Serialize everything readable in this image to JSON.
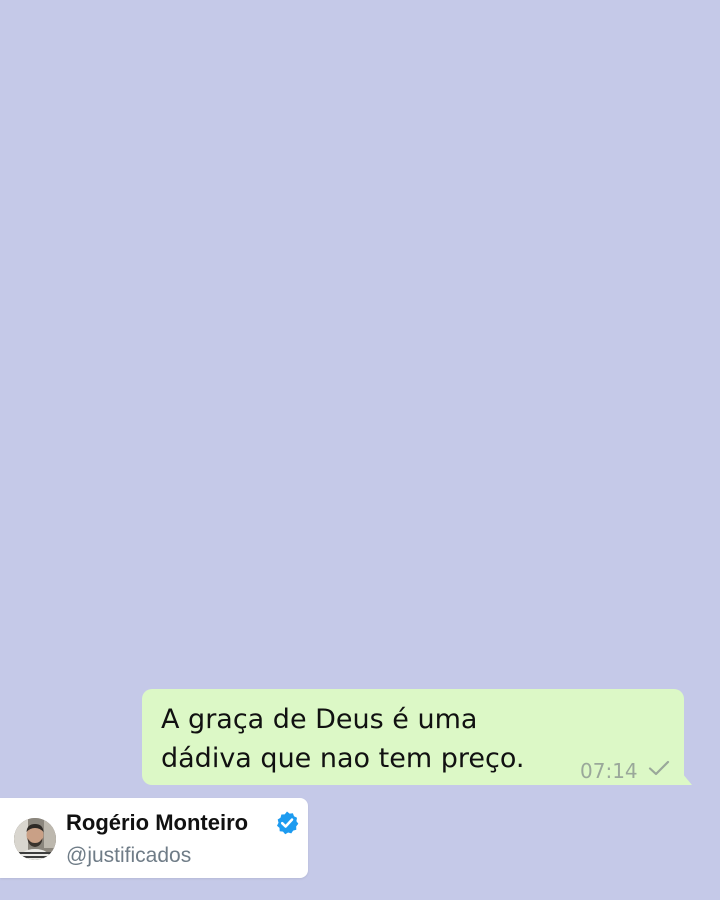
{
  "chat": {
    "background_color": "#c5c9e8",
    "message": {
      "lines": [
        "A graça de Deus é uma",
        "dádiva que nao tem preço."
      ],
      "time": "07:14",
      "status_icon": "single-check-icon",
      "bubble_color": "#dcf8c6"
    }
  },
  "profile": {
    "name": "Rogério Monteiro",
    "handle": "@justificados",
    "verified_icon": "verified-badge-icon",
    "verified_color": "#1d9bf0"
  }
}
